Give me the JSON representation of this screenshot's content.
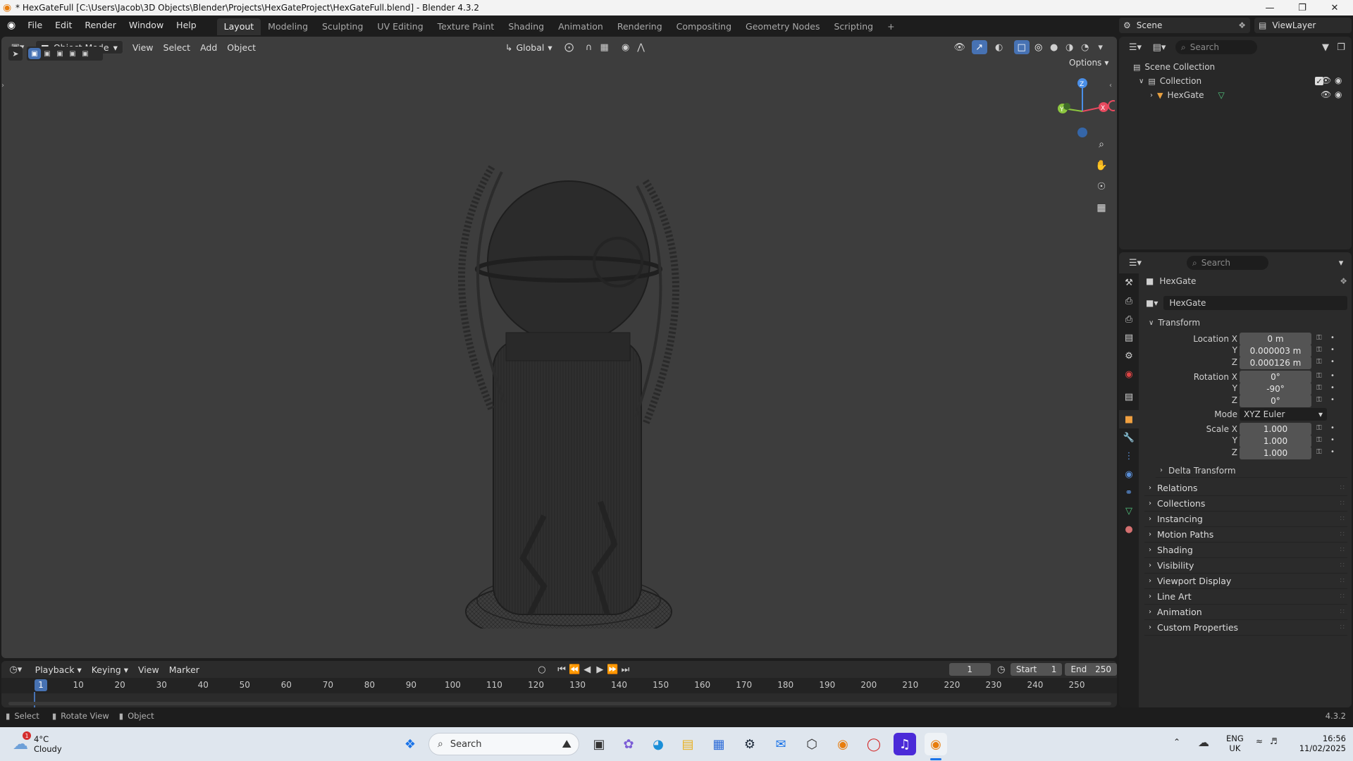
{
  "window": {
    "title": "* HexGateFull [C:\\Users\\Jacob\\3D Objects\\Blender\\Projects\\HexGateProject\\HexGateFull.blend] - Blender 4.3.2"
  },
  "menu": [
    "File",
    "Edit",
    "Render",
    "Window",
    "Help"
  ],
  "workspaces": [
    "Layout",
    "Modeling",
    "Sculpting",
    "UV Editing",
    "Texture Paint",
    "Shading",
    "Animation",
    "Rendering",
    "Compositing",
    "Geometry Nodes",
    "Scripting"
  ],
  "active_workspace": "Layout",
  "scene": {
    "label": "Scene",
    "viewlayer": "ViewLayer"
  },
  "viewport": {
    "mode": "Object Mode",
    "menus": [
      "View",
      "Select",
      "Add",
      "Object"
    ],
    "transform_orientation": "Global",
    "options_label": "Options",
    "gizmo_axes": {
      "x": "X",
      "y": "Y",
      "z": "Z"
    }
  },
  "outliner": {
    "search_placeholder": "Search",
    "items": [
      {
        "label": "Scene Collection"
      },
      {
        "label": "Collection"
      },
      {
        "label": "HexGate"
      }
    ]
  },
  "properties": {
    "search_placeholder": "Search",
    "object_name": "HexGate",
    "object_field": "HexGate",
    "transform_label": "Transform",
    "location": {
      "label": "Location X",
      "x": "0 m",
      "y": "0.000003 m",
      "z": "0.000126 m"
    },
    "rotation": {
      "label": "Rotation X",
      "x": "0°",
      "y": "-90°",
      "z": "0°"
    },
    "mode": {
      "label": "Mode",
      "value": "XYZ Euler"
    },
    "scale": {
      "label": "Scale X",
      "x": "1.000",
      "y": "1.000",
      "z": "1.000"
    },
    "axis_y": "Y",
    "axis_z": "Z",
    "delta_transform": "Delta Transform",
    "panels": [
      "Relations",
      "Collections",
      "Instancing",
      "Motion Paths",
      "Shading",
      "Visibility",
      "Viewport Display",
      "Line Art",
      "Animation",
      "Custom Properties"
    ]
  },
  "timeline": {
    "menus": [
      "Playback",
      "Keying",
      "View",
      "Marker"
    ],
    "current_frame": "1",
    "start_label": "Start",
    "start": "1",
    "end_label": "End",
    "end": "250",
    "ticks": [
      "1",
      "10",
      "20",
      "30",
      "40",
      "50",
      "60",
      "70",
      "80",
      "90",
      "100",
      "110",
      "120",
      "130",
      "140",
      "150",
      "160",
      "170",
      "180",
      "190",
      "200",
      "210",
      "220",
      "230",
      "240",
      "250"
    ]
  },
  "status": {
    "select": "Select",
    "rotate": "Rotate View",
    "object": "Object",
    "version": "4.3.2"
  },
  "taskbar": {
    "weather_temp": "4°C",
    "weather_desc": "Cloudy",
    "weather_badge": "1",
    "search_label": "Search",
    "lang": "ENG",
    "region": "UK",
    "time": "16:56",
    "date": "11/02/2025"
  },
  "colors": {
    "accent": "#4772b3",
    "x_axis": "#e84a5f",
    "y_axis": "#8cc63f",
    "z_axis": "#4a8fe8"
  }
}
